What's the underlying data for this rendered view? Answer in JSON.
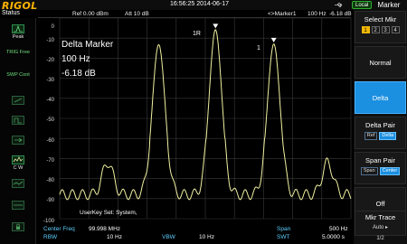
{
  "app": {
    "logo": "RIGOL"
  },
  "header": {
    "datetime": "16:56:25 2014-06-17",
    "remote_badge": "Local",
    "menu_title": "Marker"
  },
  "status_label": "Status",
  "info_row": {
    "ref": "Ref  0.00 dBm",
    "att": "Att   10 dB",
    "marker_readout_label": "<>Marker1",
    "marker_readout_freq": "100 Hz",
    "marker_readout_level": "-6.18 dB"
  },
  "status_items": [
    {
      "icon": "peak-detector-icon",
      "label": "Peak"
    },
    {
      "icon": "trig-free-icon",
      "label": "TRIG\nFree"
    },
    {
      "icon": "sweep-cont-icon",
      "label": "SWP\nCont"
    },
    {
      "icon": "correction-off-icon",
      "label": "Corr"
    },
    {
      "icon": "gate-off-icon",
      "label": "Off"
    },
    {
      "icon": "ext-ref-icon",
      "label": ""
    },
    {
      "icon": "trace-clear-write-icon",
      "label": "C W"
    },
    {
      "icon": "trace-blank-icon",
      "label": ""
    },
    {
      "icon": "trace-blank-2-icon",
      "label": ""
    },
    {
      "icon": "lock-icon",
      "label": ""
    }
  ],
  "y_axis": {
    "ticks": [
      "0",
      "-10",
      "-20",
      "-30",
      "-40",
      "-50",
      "-60",
      "-70",
      "-80",
      "-90",
      "-100"
    ]
  },
  "delta_box": {
    "title": "Delta Marker",
    "freq": "100 Hz",
    "level": "-6.18 dB"
  },
  "user_key": "UserKey Set:   System,",
  "marker_labels": {
    "ref": "1R",
    "active": "1"
  },
  "bottom": {
    "center_freq_label": "Center Freq",
    "center_freq_value": "99.998 MHz",
    "rbw_label": "RBW",
    "rbw_value": "10 Hz",
    "vbw_label": "VBW",
    "vbw_value": "10 Hz",
    "span_label": "Span",
    "span_value": "500 Hz",
    "swt_label": "SWT",
    "swt_value": "5.0000 s"
  },
  "menu": {
    "select_mkr": {
      "title": "Select Mkr",
      "options": [
        "1",
        "2",
        "3",
        "4"
      ],
      "selected": "1"
    },
    "normal": "Normal",
    "delta": "Delta",
    "delta_pair": {
      "title": "Delta Pair",
      "options": [
        "Ref",
        "Delta"
      ],
      "selected": "Delta"
    },
    "span_pair": {
      "title": "Span Pair",
      "options": [
        "Span",
        "Center"
      ],
      "selected": "Center"
    },
    "off": "Off",
    "mkr_trace": {
      "title": "Mkr Trace",
      "value": "Auto",
      "arrow": "▸"
    },
    "page": "1/2"
  },
  "colors": {
    "trace": "#f0f0a0",
    "grid": "#3a3a3a",
    "active_softkey": "#1b8fe0",
    "logo": "#ffb400"
  }
}
